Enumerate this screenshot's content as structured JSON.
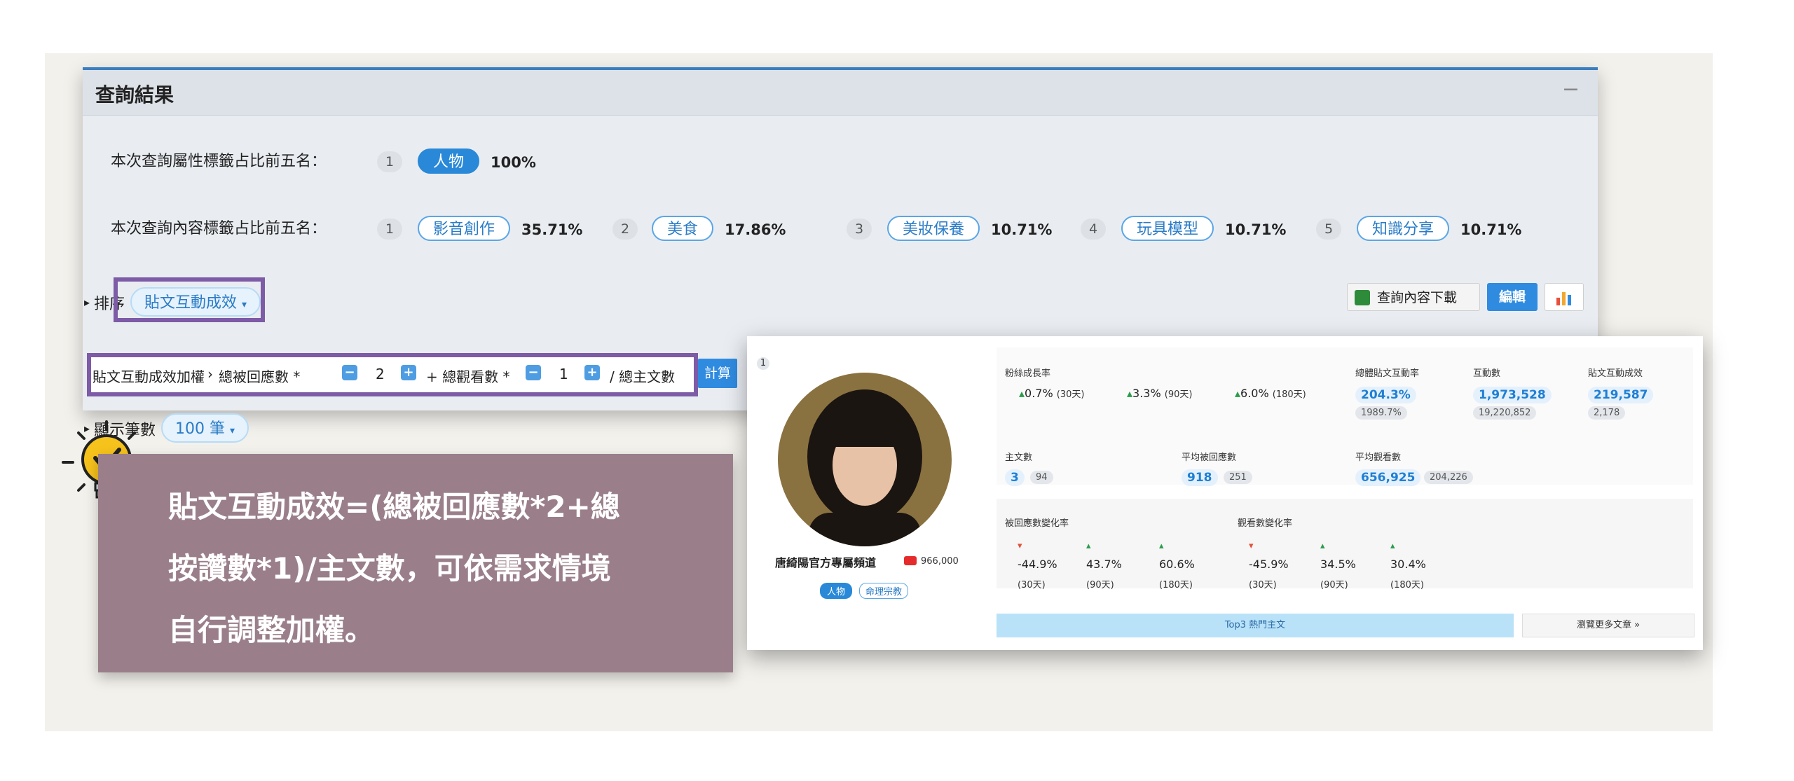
{
  "panel": {
    "title": "查詢結果",
    "collapse_label": "−",
    "attr_label": "本次查詢屬性標籤占比前五名：",
    "attr_tags": [
      {
        "rank": "1",
        "name": "人物",
        "pct": "100%"
      }
    ],
    "content_label": "本次查詢內容標籤占比前五名：",
    "content_tags": [
      {
        "rank": "1",
        "name": "影音創作",
        "pct": "35.71%"
      },
      {
        "rank": "2",
        "name": "美食",
        "pct": "17.86%"
      },
      {
        "rank": "3",
        "name": "美妝保養",
        "pct": "10.71%"
      },
      {
        "rank": "4",
        "name": "玩具模型",
        "pct": "10.71%"
      },
      {
        "rank": "5",
        "name": "知識分享",
        "pct": "10.71%"
      }
    ],
    "sort_label": "排序",
    "sort_value": "貼文互動成效",
    "weight": {
      "label": "貼文互動成效加權",
      "term1": "總被回應數 *",
      "value1": "2",
      "term2": "+ 總觀看數 *",
      "value2": "1",
      "term3": "/ 總主文數",
      "calc": "計算"
    },
    "count_label": "顯示筆數",
    "count_value": "100 筆",
    "download_label": "查詢內容下載",
    "edit_label": "編輯"
  },
  "card": {
    "index": "1",
    "channel_name": "唐綺陽官方專屬頻道",
    "subscribers": "966,000",
    "tags": [
      "人物",
      "命理宗教"
    ],
    "fan_growth_label": "粉絲成長率",
    "fan_growth": [
      {
        "value": "0.7%",
        "period": "(30天)"
      },
      {
        "value": "3.3%",
        "period": "(90天)"
      },
      {
        "value": "6.0%",
        "period": "(180天)"
      }
    ],
    "overall_rate_label": "總體貼文互動率",
    "overall_rate": "204.3%",
    "overall_rate_avg": "1989.7%",
    "interactions_label": "互動數",
    "interactions": "1,973,528",
    "interactions_avg": "19,220,852",
    "post_effect_label": "貼文互動成效",
    "post_effect": "219,587",
    "post_effect_avg": "2,178",
    "posts_label": "主文數",
    "posts": "3",
    "posts_avg": "94",
    "avg_reply_label": "平均被回應數",
    "avg_reply": "918",
    "avg_reply_avg": "251",
    "avg_view_label": "平均觀看數",
    "avg_view": "656,925",
    "avg_view_avg": "204,226",
    "reply_change_label": "被回應數變化率",
    "reply_change": [
      {
        "value": "-44.9%",
        "period": "(30天)"
      },
      {
        "value": "43.7%",
        "period": "(90天)"
      },
      {
        "value": "60.6%",
        "period": "(180天)"
      }
    ],
    "view_change_label": "觀看數變化率",
    "view_change": [
      {
        "value": "-45.9%",
        "period": "(30天)"
      },
      {
        "value": "34.5%",
        "period": "(90天)"
      },
      {
        "value": "30.4%",
        "period": "(180天)"
      }
    ],
    "top3_label": "Top3 熱門主文",
    "more_label": "瀏覽更多文章 »"
  },
  "callout": {
    "lines": [
      "貼文互動成效=(總被回應數*2+總",
      "按讚數*1)/主文數，可依需求情境",
      "自行調整加權。"
    ]
  },
  "colors": {
    "accent": "#2989d8",
    "highlight": "#7d5ba6",
    "callout_bg": "#9a7f8b"
  }
}
